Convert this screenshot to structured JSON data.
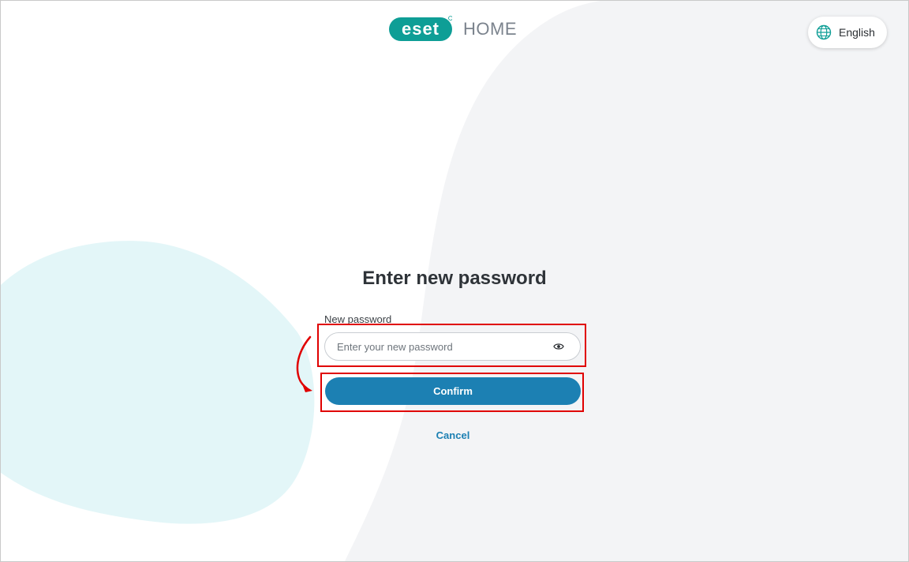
{
  "header": {
    "logo_text": "eset",
    "logo_suffix": "HOME",
    "language_label": "English"
  },
  "icons": {
    "language": "globe-icon",
    "toggle_visibility": "eye-icon"
  },
  "main": {
    "title": "Enter new password",
    "password_label": "New password",
    "password_placeholder": "Enter your new password",
    "password_value": "",
    "confirm_label": "Confirm",
    "cancel_label": "Cancel"
  },
  "colors": {
    "brand_teal": "#0e9e96",
    "primary_button": "#1c80b3",
    "link": "#1c80b3",
    "annotation_red": "#e00000",
    "bg_blob_gray": "#f3f4f6",
    "bg_blob_cyan": "#e3f6f8"
  }
}
